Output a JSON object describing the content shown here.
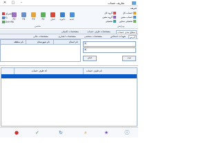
{
  "window": {
    "title": "تعاریف حساب"
  },
  "ribbon": {
    "tab_label": "تعریف",
    "group_label": "ویرایش",
    "left_group_label": "ماشین",
    "buttons": [
      {
        "label": "جدید"
      },
      {
        "label": "ذخیره"
      },
      {
        "label": "حذف"
      },
      {
        "label": "F2"
      },
      {
        "label": "F3"
      },
      {
        "label": "F4"
      },
      {
        "label": "F5"
      }
    ],
    "small_buttons": [
      {
        "label": "انصراف"
      },
      {
        "label": "F1"
      },
      {
        "label": "Ctrl+F6"
      },
      {
        "label": "Ctrl+N"
      }
    ],
    "right_items": [
      {
        "label": "گروه کل"
      },
      {
        "label": "گروه معین"
      },
      {
        "label": "تفصیلی"
      }
    ],
    "right_small_items": [
      {
        "label": "حساب کل"
      },
      {
        "label": "حساب معین"
      },
      {
        "label": "تفصیلی شناور"
      }
    ]
  },
  "tabs_row1": [
    {
      "label": "سطح بندی حساب"
    },
    {
      "label": "مشخصات طرف حساب"
    },
    {
      "label": "مشخصات تکمیلی"
    }
  ],
  "tabs_row2": [
    {
      "label": "آدرس"
    },
    {
      "label": "تعهدات اشخاص"
    },
    {
      "label": "مشخصات شخصی"
    },
    {
      "label": "مشخصات اعتباری"
    },
    {
      "label": "مشخصات مالی"
    }
  ],
  "grid1": {
    "columns": [
      "نام استان",
      "نام شهرستان",
      "نام منطقه"
    ]
  },
  "form": {
    "combo1_value": "",
    "combo2_value": "",
    "add_button": "ثبت",
    "remove_button": "حذف"
  },
  "grid2": {
    "columns": [
      "نام طرف حساب",
      "کد طرف حساب"
    ]
  },
  "colors": {
    "selection": "#0a5ac8",
    "ribbon_bg": "#f4f7fb",
    "border": "#9fb3cc"
  }
}
